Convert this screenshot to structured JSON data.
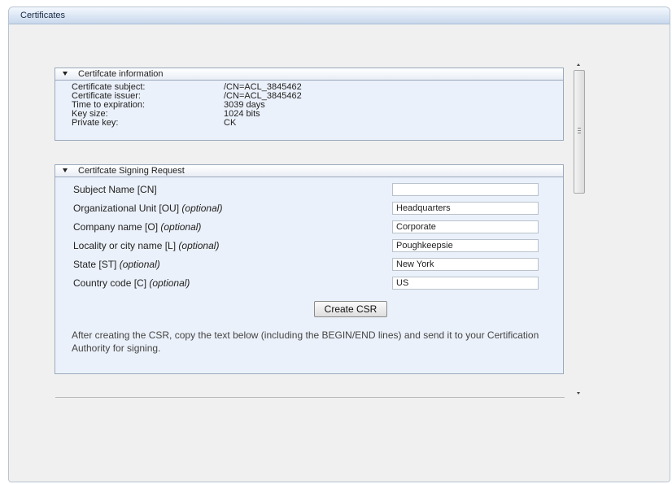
{
  "window": {
    "title": "Certificates"
  },
  "info_panel": {
    "header": "Certifcate information",
    "rows": [
      {
        "label": "Certificate subject:",
        "value": "/CN=ACL_3845462"
      },
      {
        "label": "Certificate issuer:",
        "value": "/CN=ACL_3845462"
      },
      {
        "label": "Time to expiration:",
        "value": "3039 days"
      },
      {
        "label": "Key size:",
        "value": "1024 bits"
      },
      {
        "label": "Private key:",
        "value": "CK"
      }
    ]
  },
  "csr_panel": {
    "header": "Certifcate Signing Request",
    "fields": [
      {
        "label": "Subject Name [CN]",
        "optional": "",
        "value": ""
      },
      {
        "label": "Organizational Unit [OU]",
        "optional": "(optional)",
        "value": "Headquarters"
      },
      {
        "label": "Company name [O]",
        "optional": "(optional)",
        "value": "Corporate"
      },
      {
        "label": "Locality or city name [L]",
        "optional": "(optional)",
        "value": "Poughkeepsie"
      },
      {
        "label": "State [ST]",
        "optional": "(optional)",
        "value": "New York"
      },
      {
        "label": "Country code [C]",
        "optional": "(optional)",
        "value": "US"
      }
    ],
    "button_label": "Create CSR",
    "note": "After creating the CSR, copy the text below (including the BEGIN/END lines) and send it to your Certification Authority for signing."
  }
}
